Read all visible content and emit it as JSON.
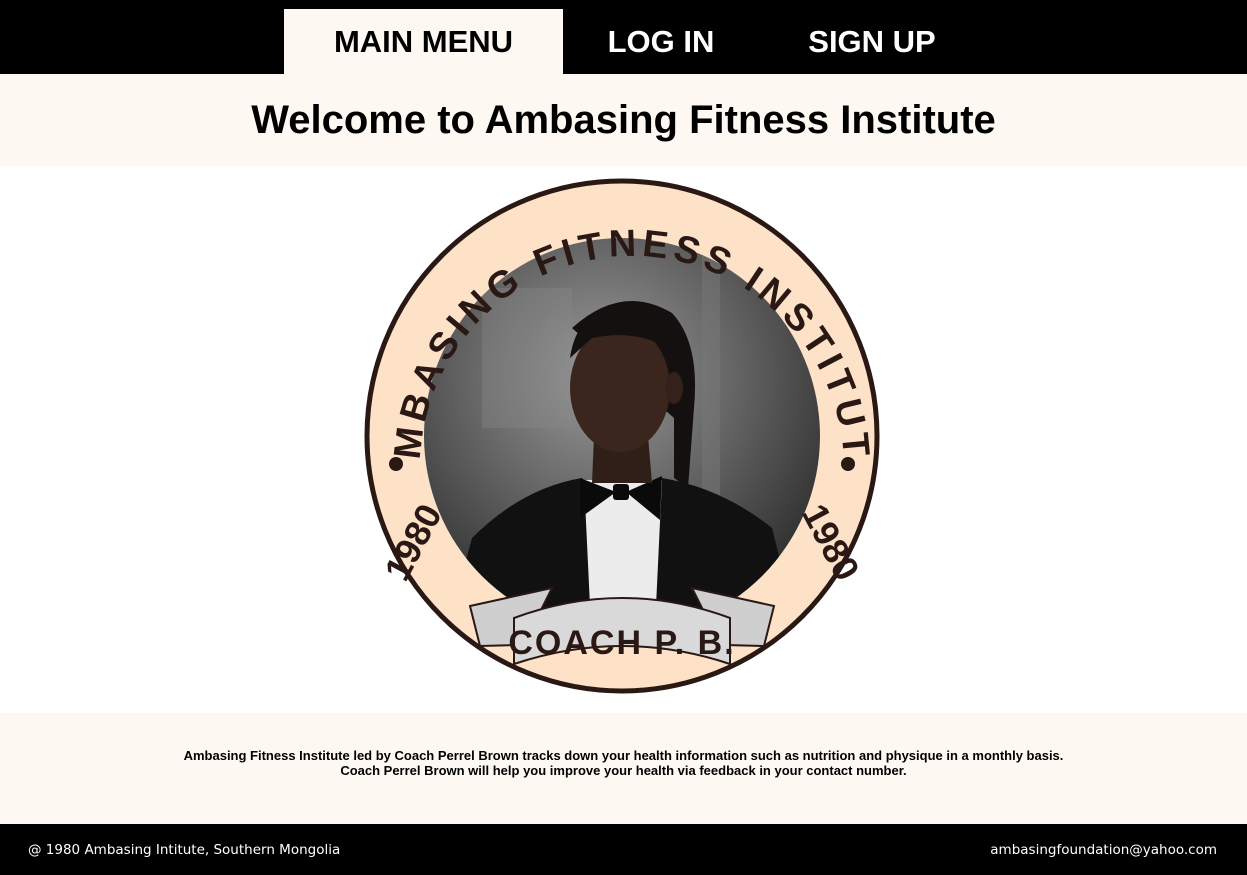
{
  "nav": {
    "tabs": [
      {
        "label": "MAIN MENU",
        "active": true
      },
      {
        "label": "LOG IN",
        "active": false
      },
      {
        "label": "SIGN UP",
        "active": false
      }
    ]
  },
  "header": {
    "title": "Welcome to Ambasing Fitness Institute"
  },
  "logo": {
    "ring_text": "AMBASING FITNESS INSTITUTE",
    "year_left": "1980",
    "year_right": "1980",
    "banner_text": "COACH P. B.",
    "colors": {
      "ring_fill": "#fde2c8",
      "ring_stroke": "#2a1815",
      "text": "#2a1815",
      "banner": "#cfcfcf"
    }
  },
  "info": {
    "line1": "Ambasing Fitness Institute led by Coach Perrel Brown tracks down your health information such as nutrition and physique in a monthly basis.",
    "line2": "Coach Perrel Brown will help you improve your health via feedback in your contact number."
  },
  "footer": {
    "copyright": "@ 1980 Ambasing Intitute, Southern Mongolia",
    "email": "ambasingfoundation@yahoo.com"
  },
  "colors": {
    "nav_bg": "#000000",
    "section_bg": "#fdf8f1",
    "footer_bg": "#000000"
  }
}
